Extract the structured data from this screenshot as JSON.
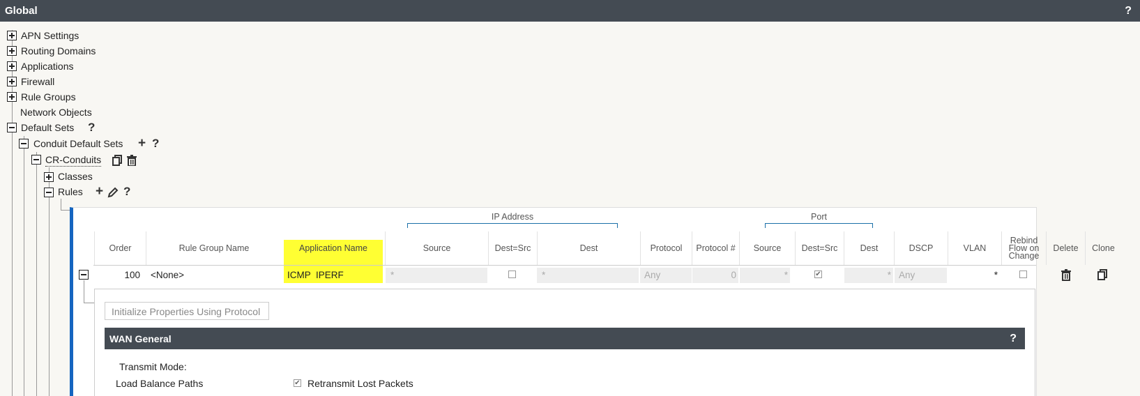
{
  "header": {
    "title": "Global",
    "help": "?"
  },
  "tree": {
    "apn_settings": "APN Settings",
    "routing_domains": "Routing Domains",
    "applications": "Applications",
    "firewall": "Firewall",
    "rule_groups": "Rule Groups",
    "network_objects": "Network Objects",
    "default_sets": "Default Sets",
    "default_sets_help": "?",
    "conduit_default_sets": "Conduit Default Sets",
    "conduit_add": "+",
    "conduit_help": "?",
    "cr_conduits": "CR-Conduits",
    "classes": "Classes",
    "rules": "Rules",
    "rules_add": "+",
    "rules_help": "?"
  },
  "rules_table": {
    "groups": {
      "ip_address": "IP Address",
      "port": "Port"
    },
    "columns": {
      "order": "Order",
      "rule_group_name": "Rule Group Name",
      "application_name": "Application Name",
      "source": "Source",
      "dest_eq_src": "Dest=Src",
      "dest": "Dest",
      "protocol": "Protocol",
      "protocol_num": "Protocol #",
      "port_source": "Source",
      "port_dest_eq_src": "Dest=Src",
      "port_dest": "Dest",
      "dscp": "DSCP",
      "vlan": "VLAN",
      "rebind": "Rebind Flow on Change",
      "delete": "Delete",
      "clone": "Clone"
    },
    "row": {
      "order": "100",
      "rule_group_name": "<None>",
      "application_name": "ICMP  IPERF",
      "source": "*",
      "dest_eq_src": false,
      "dest": "*",
      "protocol": "Any",
      "protocol_num": "0",
      "port_source": "*",
      "port_dest_eq_src": true,
      "port_dest": "*",
      "dscp": "Any",
      "vlan": "*",
      "rebind": false
    }
  },
  "rule_details": {
    "init_button": "Initialize Properties Using Protocol",
    "section_title": "WAN General",
    "section_help": "?",
    "transmit_mode_label": "Transmit Mode:",
    "transmit_mode_value": "Load Balance Paths",
    "retransmit_label": "Retransmit Lost Packets",
    "retransmit_checked": true
  },
  "colors": {
    "header_bg": "#444b53",
    "accent": "#1565c0",
    "highlight": "#ffff33"
  }
}
